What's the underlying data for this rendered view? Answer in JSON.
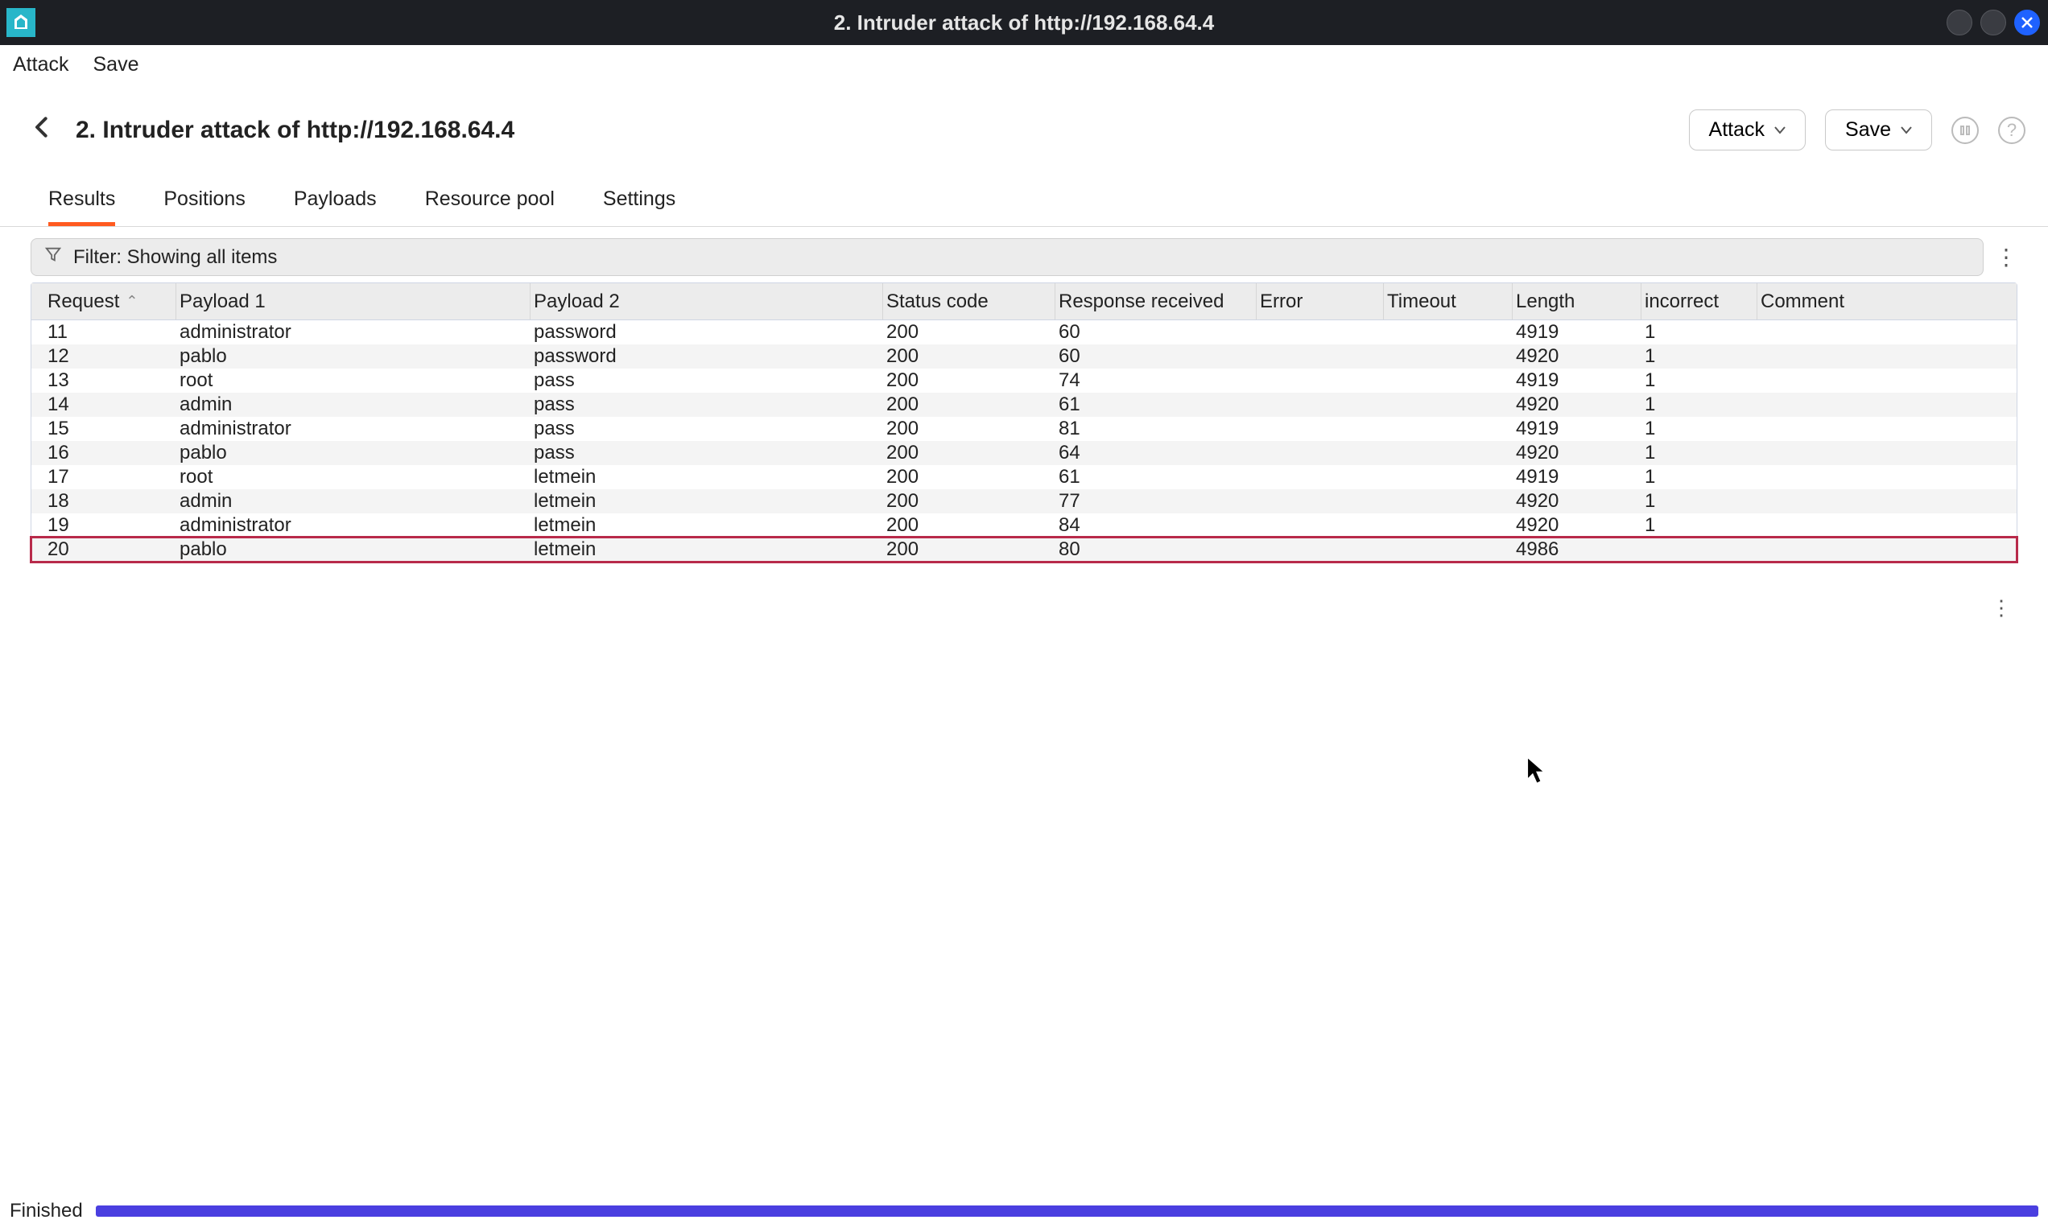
{
  "window": {
    "title": "2. Intruder attack of http://192.168.64.4"
  },
  "menubar": {
    "items": [
      "Attack",
      "Save"
    ]
  },
  "header": {
    "page_title": "2. Intruder attack of http://192.168.64.4",
    "attack_button": "Attack",
    "save_button": "Save"
  },
  "tabs": {
    "items": [
      "Results",
      "Positions",
      "Payloads",
      "Resource pool",
      "Settings"
    ],
    "active_index": 0
  },
  "filter": {
    "label": "Filter: Showing all items"
  },
  "table": {
    "columns": [
      "Request",
      "Payload 1",
      "Payload 2",
      "Status code",
      "Response received",
      "Error",
      "Timeout",
      "Length",
      "incorrect",
      "Comment"
    ],
    "sort_column": 0,
    "rows": [
      {
        "request": "11",
        "payload1": "administrator",
        "payload2": "password",
        "status": "200",
        "response": "60",
        "error": "",
        "timeout": "",
        "length": "4919",
        "incorrect": "1",
        "comment": "",
        "highlight": false
      },
      {
        "request": "12",
        "payload1": "pablo",
        "payload2": "password",
        "status": "200",
        "response": "60",
        "error": "",
        "timeout": "",
        "length": "4920",
        "incorrect": "1",
        "comment": "",
        "highlight": false
      },
      {
        "request": "13",
        "payload1": "root",
        "payload2": "pass",
        "status": "200",
        "response": "74",
        "error": "",
        "timeout": "",
        "length": "4919",
        "incorrect": "1",
        "comment": "",
        "highlight": false
      },
      {
        "request": "14",
        "payload1": "admin",
        "payload2": "pass",
        "status": "200",
        "response": "61",
        "error": "",
        "timeout": "",
        "length": "4920",
        "incorrect": "1",
        "comment": "",
        "highlight": false
      },
      {
        "request": "15",
        "payload1": "administrator",
        "payload2": "pass",
        "status": "200",
        "response": "81",
        "error": "",
        "timeout": "",
        "length": "4919",
        "incorrect": "1",
        "comment": "",
        "highlight": false
      },
      {
        "request": "16",
        "payload1": "pablo",
        "payload2": "pass",
        "status": "200",
        "response": "64",
        "error": "",
        "timeout": "",
        "length": "4920",
        "incorrect": "1",
        "comment": "",
        "highlight": false
      },
      {
        "request": "17",
        "payload1": "root",
        "payload2": "letmein",
        "status": "200",
        "response": "61",
        "error": "",
        "timeout": "",
        "length": "4919",
        "incorrect": "1",
        "comment": "",
        "highlight": false
      },
      {
        "request": "18",
        "payload1": "admin",
        "payload2": "letmein",
        "status": "200",
        "response": "77",
        "error": "",
        "timeout": "",
        "length": "4920",
        "incorrect": "1",
        "comment": "",
        "highlight": false
      },
      {
        "request": "19",
        "payload1": "administrator",
        "payload2": "letmein",
        "status": "200",
        "response": "84",
        "error": "",
        "timeout": "",
        "length": "4920",
        "incorrect": "1",
        "comment": "",
        "highlight": false
      },
      {
        "request": "20",
        "payload1": "pablo",
        "payload2": "letmein",
        "status": "200",
        "response": "80",
        "error": "",
        "timeout": "",
        "length": "4986",
        "incorrect": "",
        "comment": "",
        "highlight": true
      }
    ]
  },
  "status": {
    "label": "Finished",
    "progress_percent": 100
  },
  "colors": {
    "accent_orange": "#ff5a1f",
    "progress_blue": "#4a3fe0",
    "highlight_red": "#b82a4a"
  }
}
